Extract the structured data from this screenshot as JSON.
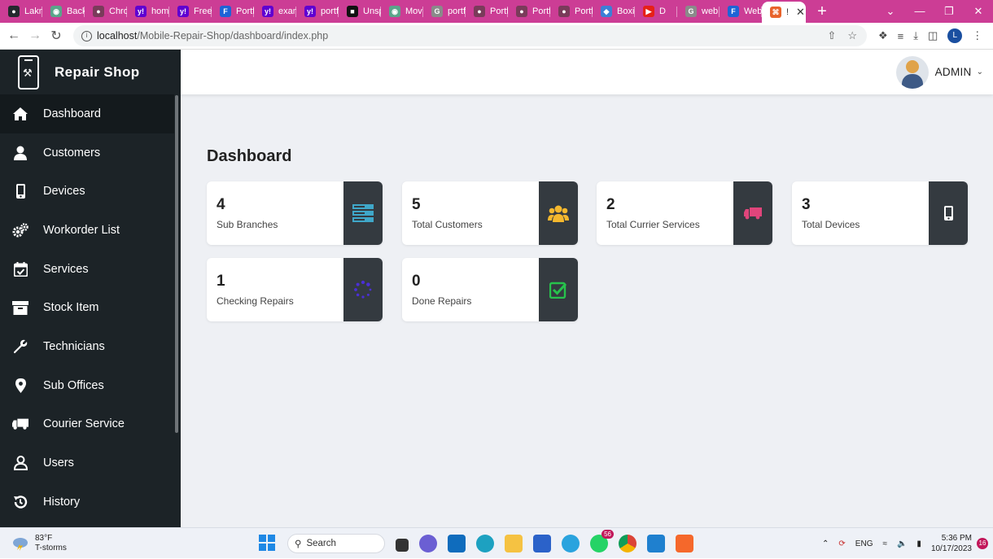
{
  "browser": {
    "tabs": [
      {
        "label": "Lakn",
        "color": "#24292e",
        "glyph": "●"
      },
      {
        "label": "Back",
        "color": "#5aa58a",
        "glyph": "◉"
      },
      {
        "label": "Chro",
        "color": "#7a3b5a",
        "glyph": "●"
      },
      {
        "label": "hom",
        "color": "#5f01d1",
        "glyph": "y!"
      },
      {
        "label": "Free",
        "color": "#5f01d1",
        "glyph": "y!"
      },
      {
        "label": "Portf",
        "color": "#1e63d6",
        "glyph": "F"
      },
      {
        "label": "exan",
        "color": "#5f01d1",
        "glyph": "y!"
      },
      {
        "label": "portf",
        "color": "#5f01d1",
        "glyph": "y!"
      },
      {
        "label": "Unsp",
        "color": "#111111",
        "glyph": "■"
      },
      {
        "label": "Mov",
        "color": "#5aa58a",
        "glyph": "◉"
      },
      {
        "label": "portf",
        "color": "#8a8a8a",
        "glyph": "G"
      },
      {
        "label": "Portf",
        "color": "#7a3b5a",
        "glyph": "●"
      },
      {
        "label": "Portf",
        "color": "#7a3b5a",
        "glyph": "●"
      },
      {
        "label": "Portf",
        "color": "#7a3b5a",
        "glyph": "●"
      },
      {
        "label": "Boxic",
        "color": "#3c7fd6",
        "glyph": "◆"
      },
      {
        "label": "D",
        "color": "#e62117",
        "glyph": "▶"
      },
      {
        "label": "web",
        "color": "#8a8a8a",
        "glyph": "G"
      },
      {
        "label": "Web",
        "color": "#1e63d6",
        "glyph": "F"
      },
      {
        "label": "!",
        "color": "#e8632b",
        "glyph": "⌘",
        "active": true
      }
    ],
    "address": {
      "host": "localhost",
      "path": "/Mobile-Repair-Shop/dashboard/index.php"
    },
    "profile_initial": "L"
  },
  "sidebar": {
    "brand": "Repair Shop",
    "items": [
      {
        "label": "Dashboard",
        "icon": "home-icon"
      },
      {
        "label": "Customers",
        "icon": "user-icon"
      },
      {
        "label": "Devices",
        "icon": "mobile-icon"
      },
      {
        "label": "Workorder List",
        "icon": "cogs-icon"
      },
      {
        "label": "Services",
        "icon": "calendar-check-icon"
      },
      {
        "label": "Stock Item",
        "icon": "archive-icon"
      },
      {
        "label": "Technicians",
        "icon": "wrench-icon"
      },
      {
        "label": "Sub Offices",
        "icon": "map-pin-icon"
      },
      {
        "label": "Courier Service",
        "icon": "truck-icon"
      },
      {
        "label": "Users",
        "icon": "user-outline-icon"
      },
      {
        "label": "History",
        "icon": "history-icon"
      }
    ]
  },
  "header": {
    "user": "ADMIN"
  },
  "page": {
    "title": "Dashboard"
  },
  "cards": [
    {
      "value": "4",
      "label": "Sub Branches",
      "icon": "server-icon",
      "icon_color": "#3fa7c9"
    },
    {
      "value": "5",
      "label": "Total Customers",
      "icon": "users-icon",
      "icon_color": "#f5b82e"
    },
    {
      "value": "2",
      "label": "Total Currier Services",
      "icon": "truck-icon",
      "icon_color": "#e0457b"
    },
    {
      "value": "3",
      "label": "Total Devices",
      "icon": "mobile-icon",
      "icon_color": "#ffffff"
    },
    {
      "value": "1",
      "label": "Checking Repairs",
      "icon": "spinner-icon",
      "icon_color": "#4b2fd6"
    },
    {
      "value": "0",
      "label": "Done Repairs",
      "icon": "check-square-icon",
      "icon_color": "#27c24c"
    }
  ],
  "taskbar": {
    "weather_temp": "83°F",
    "weather_desc": "T-storms",
    "search_label": "Search",
    "whatsapp_badge": "56",
    "lang": "ENG",
    "time": "5:36 PM",
    "date": "10/17/2023",
    "notifications": "16"
  }
}
